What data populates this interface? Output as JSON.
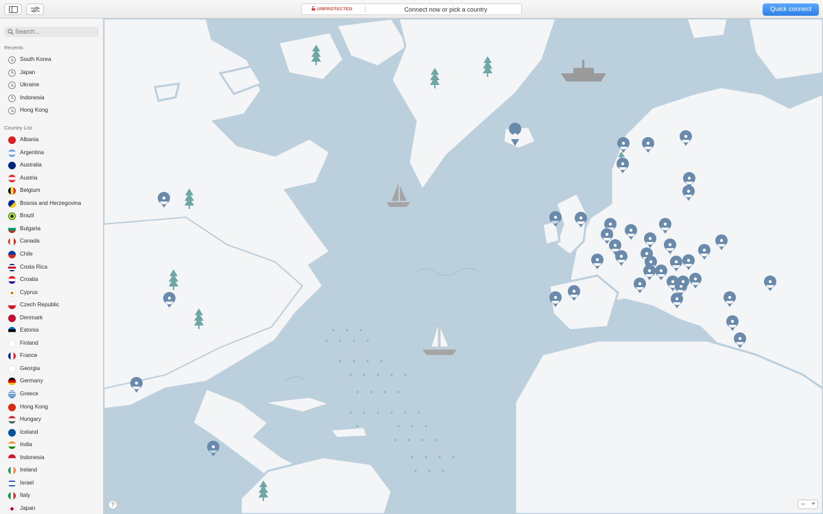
{
  "toolbar": {
    "status_label": "UNPROTECTED",
    "status_text": "Connect now or pick a country",
    "quick_connect": "Quick connect",
    "status_color": "#d9443a",
    "accent": "#3a88f0"
  },
  "sidebar": {
    "search_placeholder": "Search...",
    "recents_title": "Recents",
    "recents": [
      "South Korea",
      "Japan",
      "Ukraine",
      "Indonesia",
      "Hong Kong"
    ],
    "countries_title": "Country List",
    "countries": [
      {
        "name": "Albania",
        "flag": "albania-flag-icon"
      },
      {
        "name": "Argentina",
        "flag": "argentina-flag-icon"
      },
      {
        "name": "Australia",
        "flag": "australia-flag-icon"
      },
      {
        "name": "Austria",
        "flag": "austria-flag-icon"
      },
      {
        "name": "Belgium",
        "flag": "belgium-flag-icon"
      },
      {
        "name": "Bosnia and Herzegovina",
        "flag": "bosnia-flag-icon"
      },
      {
        "name": "Brazil",
        "flag": "brazil-flag-icon"
      },
      {
        "name": "Bulgaria",
        "flag": "bulgaria-flag-icon"
      },
      {
        "name": "Canada",
        "flag": "canada-flag-icon"
      },
      {
        "name": "Chile",
        "flag": "chile-flag-icon"
      },
      {
        "name": "Costa Rica",
        "flag": "costa-rica-flag-icon"
      },
      {
        "name": "Croatia",
        "flag": "croatia-flag-icon"
      },
      {
        "name": "Cyprus",
        "flag": "cyprus-flag-icon"
      },
      {
        "name": "Czech Republic",
        "flag": "czech-flag-icon"
      },
      {
        "name": "Denmark",
        "flag": "denmark-flag-icon"
      },
      {
        "name": "Estonia",
        "flag": "estonia-flag-icon"
      },
      {
        "name": "Finland",
        "flag": "finland-flag-icon"
      },
      {
        "name": "France",
        "flag": "france-flag-icon"
      },
      {
        "name": "Georgia",
        "flag": "georgia-flag-icon"
      },
      {
        "name": "Germany",
        "flag": "germany-flag-icon"
      },
      {
        "name": "Greece",
        "flag": "greece-flag-icon"
      },
      {
        "name": "Hong Kong",
        "flag": "hong-kong-flag-icon"
      },
      {
        "name": "Hungary",
        "flag": "hungary-flag-icon"
      },
      {
        "name": "Iceland",
        "flag": "iceland-flag-icon"
      },
      {
        "name": "India",
        "flag": "india-flag-icon"
      },
      {
        "name": "Indonesia",
        "flag": "indonesia-flag-icon"
      },
      {
        "name": "Ireland",
        "flag": "ireland-flag-icon"
      },
      {
        "name": "Israel",
        "flag": "israel-flag-icon"
      },
      {
        "name": "Italy",
        "flag": "italy-flag-icon"
      },
      {
        "name": "Japan",
        "flag": "japan-flag-icon"
      }
    ]
  },
  "map": {
    "help_label": "?",
    "zoom_out_label": "–",
    "zoom_in_label": "+",
    "land_color": "#f4f5f6",
    "water_color": "#bccfdc",
    "pin_color": "#6a8aac",
    "tree_color": "#6fa7a6"
  }
}
